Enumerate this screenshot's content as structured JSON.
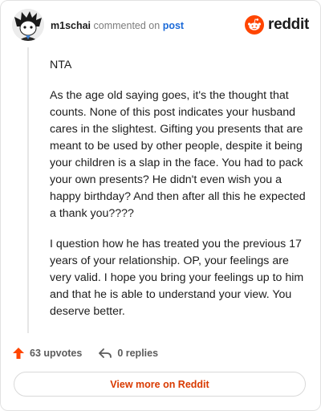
{
  "header": {
    "username": "m1schai",
    "action_text": "commented on",
    "post_link": "post",
    "brand_name": "reddit"
  },
  "comment": {
    "paragraphs": [
      "NTA",
      "As the age old saying goes, it's the thought that counts. None of this post indicates your husband cares in the slightest. Gifting you presents that are meant to be used by other people, despite it being your children is a slap in the face. You had to pack your own presents? He didn't even wish you a happy birthday? And then after all this he expected a thank you????",
      "I question how he has treated you the previous 17 years of your relationship. OP, your feelings are very valid. I hope you bring your feelings up to him and that he is able to understand your view. You deserve better."
    ]
  },
  "actions": {
    "upvotes_label": "63 upvotes",
    "replies_label": "0 replies"
  },
  "footer": {
    "view_more_label": "View more on Reddit"
  },
  "colors": {
    "accent": "#ff4500",
    "link": "#1b6ad8",
    "button_text": "#d93a00"
  },
  "icons": {
    "avatar": "avatar-icon",
    "logo": "reddit-logo-icon",
    "upvote": "upvote-arrow-icon",
    "reply": "reply-arrow-icon"
  }
}
